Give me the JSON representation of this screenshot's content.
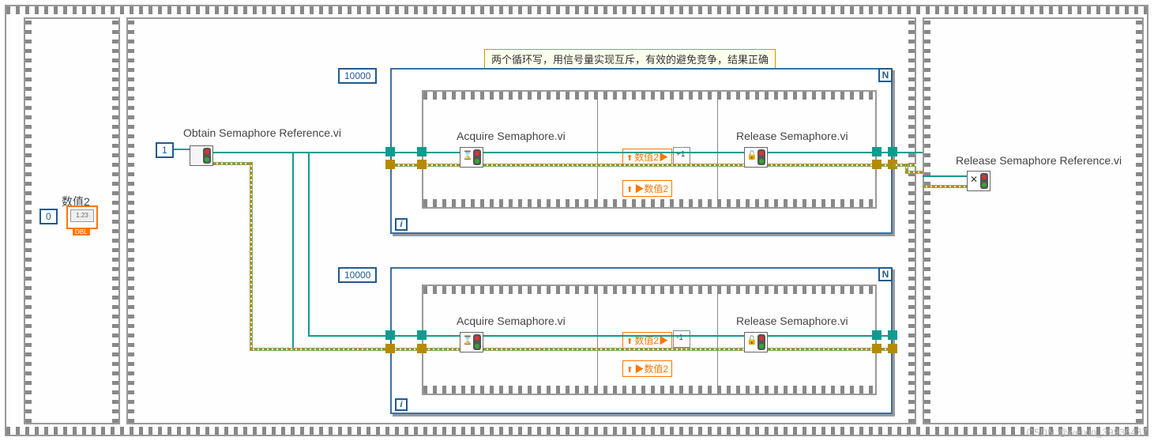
{
  "banner": "两个循环写，用信号量实现互斥，有效的避免竞争，结果正确",
  "indicator": {
    "label": "数值2",
    "init": "0"
  },
  "semaphore_size": "1",
  "obtain_label": "Obtain Semaphore Reference.vi",
  "release_ref_label": "Release Semaphore Reference.vi",
  "loop1": {
    "count": "10000",
    "acquire": "Acquire Semaphore.vi",
    "release": "Release Semaphore.vi",
    "read_local": "数值2▶",
    "write_local": "▶数值2",
    "op": "+1"
  },
  "loop2": {
    "count": "10000",
    "acquire": "Acquire Semaphore.vi",
    "release": "Release Semaphore.vi",
    "read_local": "数值2▶",
    "write_local": "▶数值2",
    "op": "-1"
  },
  "colors": {
    "wire_ref": "#0c9c8f",
    "wire_data": "#b58a00",
    "loop_border": "#3b6fa0",
    "local": "#ff7700"
  },
  "watermark": "CSDN @weixin_39936437",
  "chart_data": {
    "type": "diagram",
    "description": "LabVIEW block diagram using a semaphore (size 1) to make two parallel 10000-iteration For-loops mutually exclusive while incrementing and decrementing a shared numeric '数值2', yielding a correct final result."
  }
}
